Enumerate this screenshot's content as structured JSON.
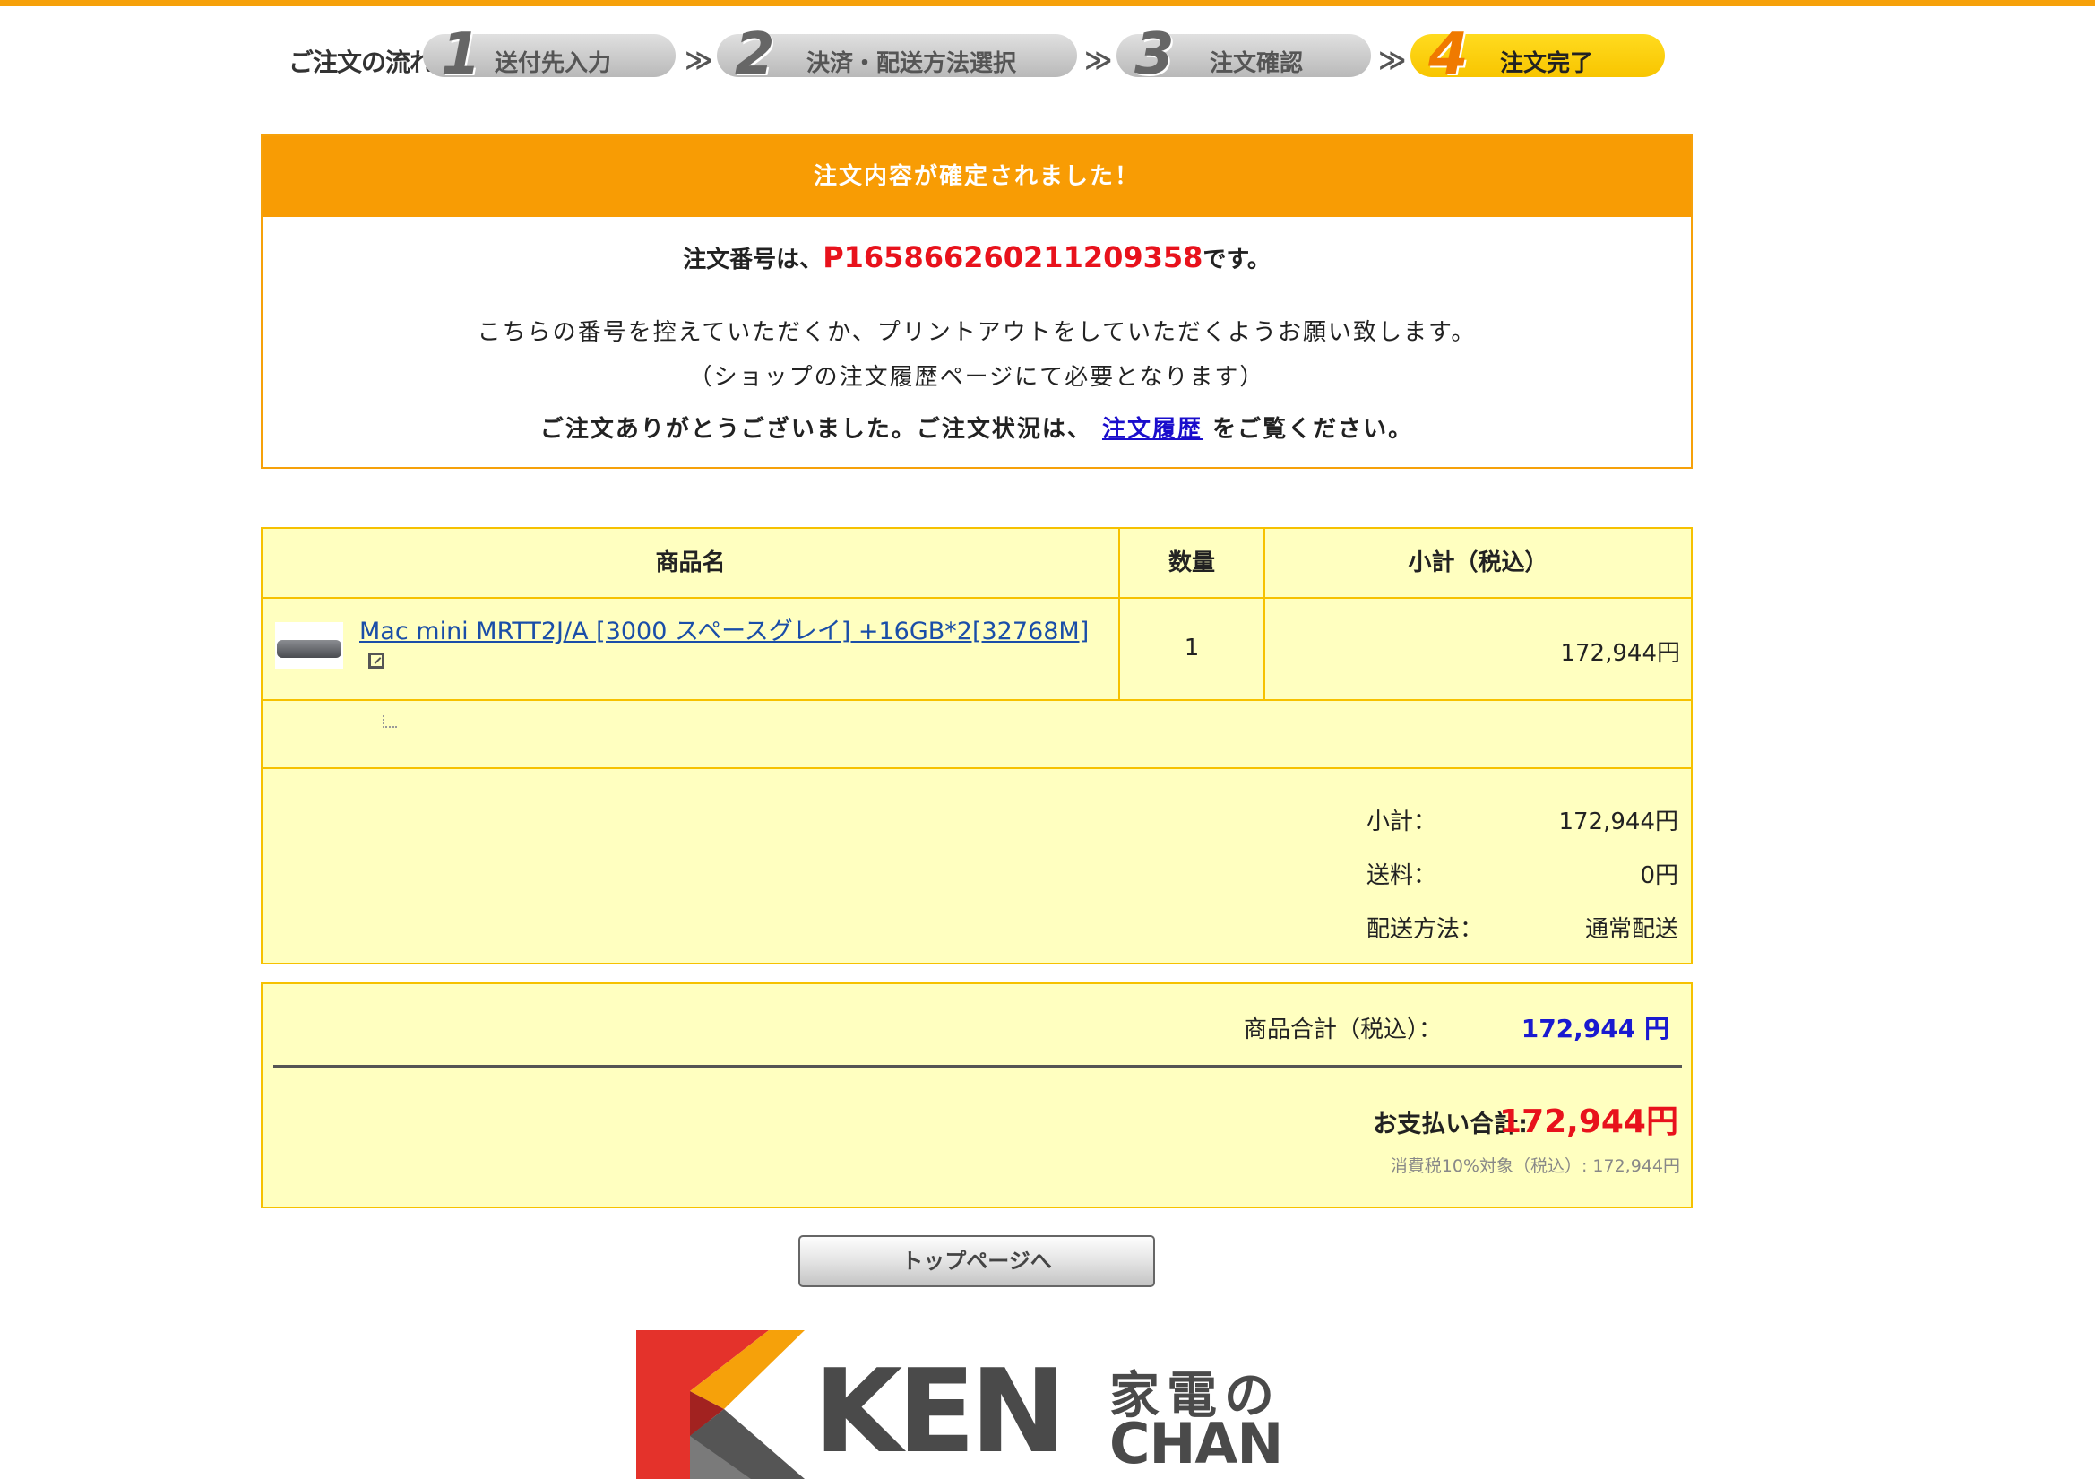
{
  "flow": {
    "label": "ご注文の流れ:",
    "steps": [
      {
        "num": "1",
        "label": "送付先入力",
        "active": false
      },
      {
        "num": "2",
        "label": "決済・配送方法選択",
        "active": false
      },
      {
        "num": "3",
        "label": "注文確認",
        "active": false
      },
      {
        "num": "4",
        "label": "注文完了",
        "active": true
      }
    ],
    "separator": "≫"
  },
  "confirm": {
    "header": "注文内容が確定されました！",
    "order_prefix": "注文番号は、",
    "order_number": "P165866260211209358",
    "order_suffix": "です。",
    "message1": "こちらの番号を控えていただくか、プリントアウトをしていただくようお願い致します。",
    "message2": "（ショップの注文履歴ページにて必要となります）",
    "message3_prefix": "ご注文ありがとうございました。ご注文状況は、",
    "history_link": "注文履歴",
    "message3_suffix": "をご覧ください。"
  },
  "items": {
    "headers": {
      "name": "商品名",
      "qty": "数量",
      "subtotal": "小計（税込）"
    },
    "rows": [
      {
        "name": "Mac mini MRTT2J/A [3000 スペースグレイ] +16GB*2[32768M]",
        "qty": "1",
        "subtotal": "172,944円"
      }
    ],
    "summary": {
      "subtotal_label": "小計：",
      "subtotal_value": "172,944円",
      "shipping_label": "送料：",
      "shipping_value": "0円",
      "method_label": "配送方法：",
      "method_value": "通常配送"
    }
  },
  "totals": {
    "goods_label": "商品合計（税込）：",
    "goods_value": "172,944 円",
    "pay_label": "お支払い合計:",
    "pay_value": "172,944円",
    "tax_note": "消費税10%対象（税込）: 172,944円"
  },
  "button": {
    "label": "トップページへ"
  },
  "logo": {
    "ken": "KEN",
    "kaden": "家電の",
    "chan": "CHAN"
  },
  "colors": {
    "accent": "#f89c04",
    "panel": "#ffffc0",
    "border": "#f6c100",
    "price_red": "#e8121c",
    "link_blue": "#1a0dcc"
  }
}
